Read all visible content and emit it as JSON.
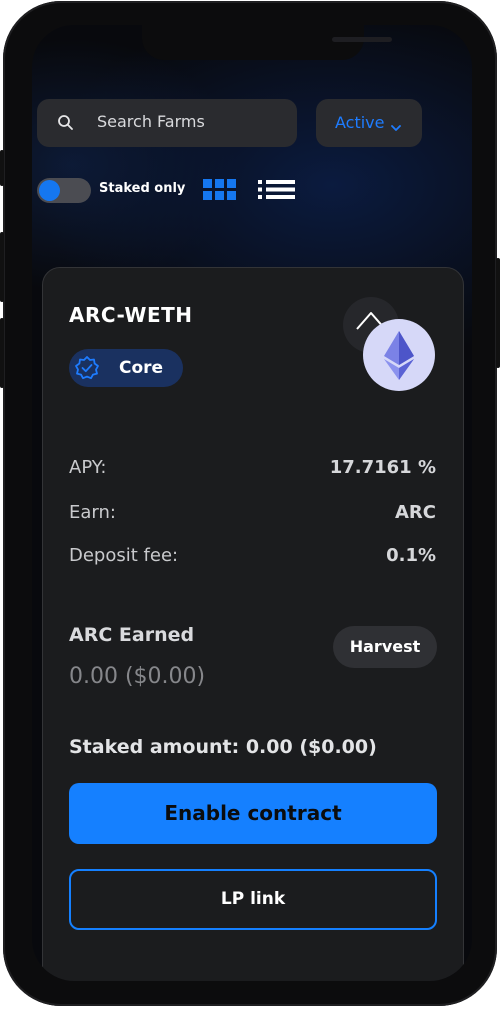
{
  "search": {
    "placeholder": "Search Farms"
  },
  "filter": {
    "selected": "Active"
  },
  "toggle": {
    "label": "Staked only",
    "on": false
  },
  "view_modes": [
    "grid-view-icon",
    "list-view-icon"
  ],
  "farm": {
    "pair": "ARC-WETH",
    "badge": "Core",
    "tokens": [
      "ARC",
      "WETH"
    ],
    "apy_label": "APY:",
    "apy_value": "17.7161 %",
    "earn_label": "Earn:",
    "earn_value": "ARC",
    "fee_label": "Deposit fee:",
    "fee_value": "0.1%",
    "earned_label": "ARC Earned",
    "earned_value": "0.00 ($0.00)",
    "harvest_label": "Harvest",
    "staked_amount": "Staked amount: 0.00 ($0.00)",
    "enable_label": "Enable contract",
    "lp_label": "LP link"
  },
  "colors": {
    "accent": "#1580ff",
    "card": "#1b1c1e",
    "badge_bg": "#1a3160",
    "eth_circle": "#d6d8f8"
  }
}
